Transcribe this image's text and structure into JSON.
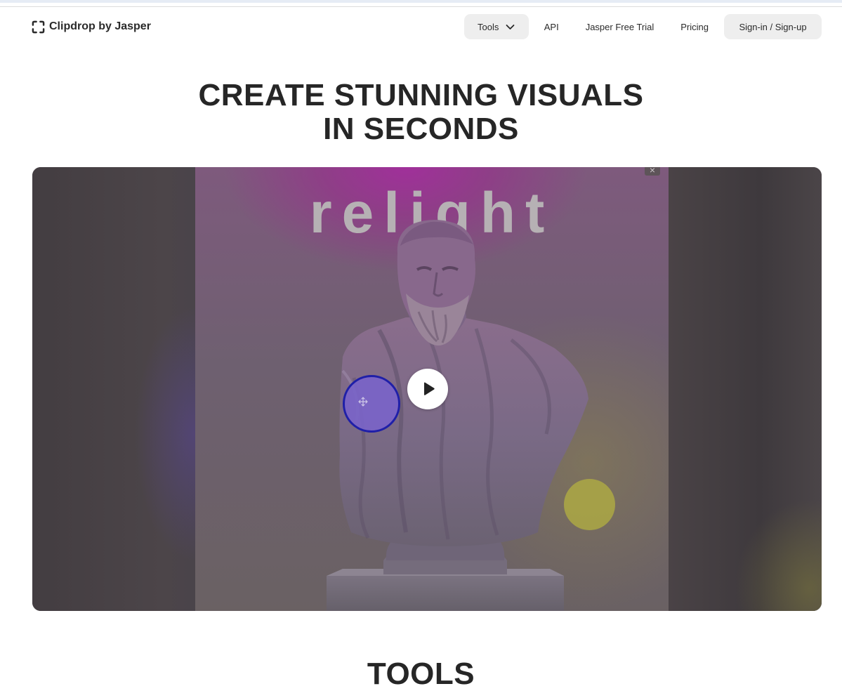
{
  "header": {
    "logo_text": "Clipdrop by Jasper",
    "nav": {
      "tools_label": "Tools",
      "api_label": "API",
      "trial_label": "Jasper Free Trial",
      "pricing_label": "Pricing",
      "signin_label": "Sign-in / Sign-up"
    }
  },
  "hero": {
    "title_line1": "CREATE STUNNING VISUALS",
    "title_line2": "IN SECONDS"
  },
  "video": {
    "overlay_text": "relight",
    "close_symbol": "×",
    "icons": [
      "play-icon",
      "move-icon",
      "close-icon"
    ],
    "light_colors": {
      "handle": "#7a64c8",
      "handle_border": "#1f1fa8",
      "secondary": "#aaa546",
      "top_glow": "#a0309a"
    }
  },
  "tools_section": {
    "heading": "TOOLS"
  }
}
